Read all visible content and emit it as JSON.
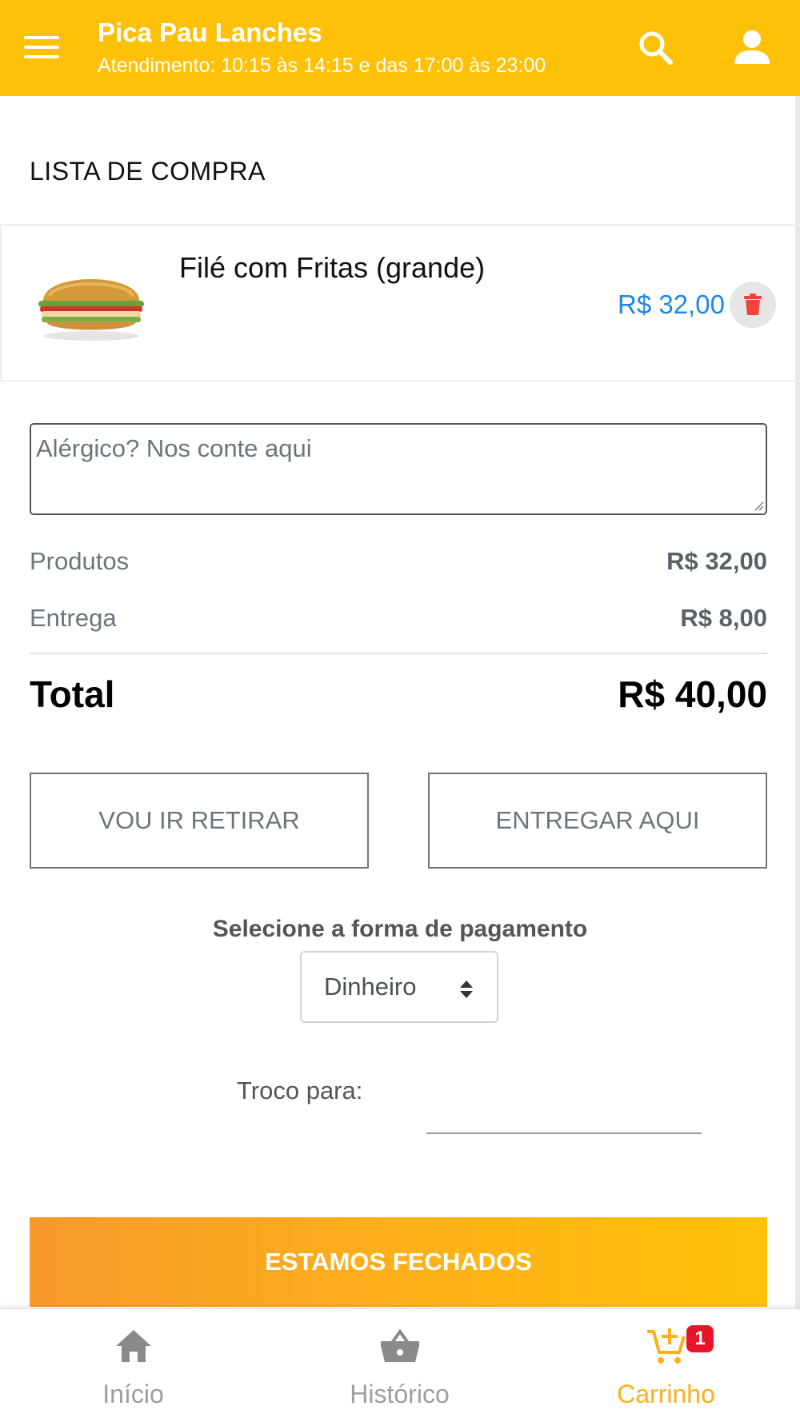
{
  "header": {
    "title": "Pica Pau Lanches",
    "subtitle": "Atendimento: 10:15 às 14:15 e das 17:00 às 23:00",
    "menu_icon": "hamburger-menu-icon",
    "search_icon": "search-icon",
    "account_icon": "user-icon"
  },
  "cart": {
    "section_title": "LISTA DE COMPRA",
    "items": [
      {
        "name": "Filé com Fritas (grande)",
        "price": "R$ 32,00",
        "image_icon": "burger-image",
        "delete_icon": "trash-icon"
      }
    ]
  },
  "notes": {
    "placeholder": "Alérgico? Nos conte aqui",
    "value": ""
  },
  "summary": {
    "products_label": "Produtos",
    "products_value": "R$ 32,00",
    "delivery_label": "Entrega",
    "delivery_value": "R$ 8,00",
    "total_label": "Total",
    "total_value": "R$ 40,00"
  },
  "delivery_options": {
    "pickup_label": "VOU IR RETIRAR",
    "deliver_label": "ENTREGAR AQUI"
  },
  "payment": {
    "label": "Selecione a forma de pagamento",
    "selected": "Dinheiro",
    "change_label": "Troco para:",
    "change_value": ""
  },
  "checkout": {
    "button_label": "ESTAMOS FECHADOS"
  },
  "bottom_nav": {
    "items": [
      {
        "label": "Início",
        "icon": "home-icon"
      },
      {
        "label": "Histórico",
        "icon": "basket-icon"
      },
      {
        "label": "Carrinho",
        "icon": "cart-plus-icon",
        "badge": "1"
      }
    ]
  },
  "colors": {
    "primary": "#ffc107",
    "accent_orange": "#f7992b",
    "price_blue": "#1e88e5",
    "delete_red": "#f44336",
    "badge_red": "#e8142a",
    "nav_inactive": "#9e9e9e",
    "nav_active": "#fcb01a"
  }
}
